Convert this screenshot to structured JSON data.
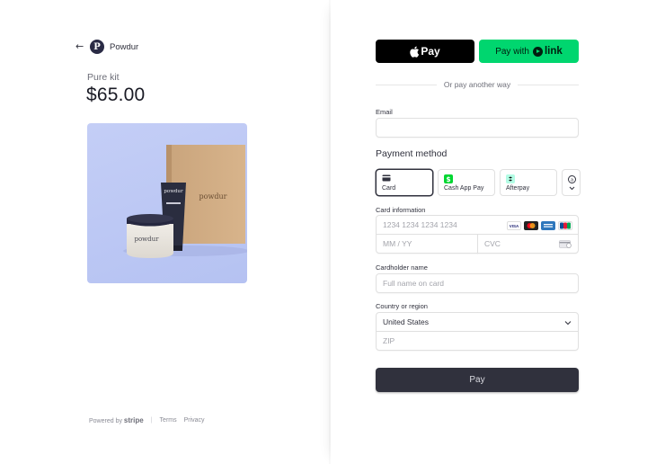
{
  "merchant": {
    "name": "Powdur",
    "logo_letter": "P"
  },
  "product": {
    "name": "Pure kit",
    "price": "$65.00",
    "box_text": "powdur",
    "tube_text": "powdur",
    "jar_text": "powdur"
  },
  "footer": {
    "powered_by": "Powered by",
    "stripe": "stripe",
    "terms": "Terms",
    "privacy": "Privacy"
  },
  "wallets": {
    "apple_pay": "Pay",
    "link_prefix": "Pay with",
    "link_brand": "link"
  },
  "divider_text": "Or pay another way",
  "email": {
    "label": "Email",
    "value": ""
  },
  "payment_method": {
    "title": "Payment method",
    "options": [
      {
        "label": "Card",
        "icon": "card-icon",
        "selected": true
      },
      {
        "label": "Cash App Pay",
        "icon": "cash-app-icon",
        "selected": false
      },
      {
        "label": "Afterpay",
        "icon": "afterpay-icon",
        "selected": false
      }
    ]
  },
  "card_info": {
    "label": "Card information",
    "number_placeholder": "1234 1234 1234 1234",
    "expiry_placeholder": "MM / YY",
    "cvc_placeholder": "CVC",
    "brands": [
      "VISA",
      "mastercard",
      "AMEX",
      "JCB"
    ]
  },
  "cardholder": {
    "label": "Cardholder name",
    "placeholder": "Full name on card"
  },
  "country": {
    "label": "Country or region",
    "selected": "United States",
    "zip_placeholder": "ZIP"
  },
  "pay_button": "Pay",
  "colors": {
    "link_green": "#00d66f",
    "pay_button": "#30313d",
    "product_bg": "#c4cef6"
  }
}
